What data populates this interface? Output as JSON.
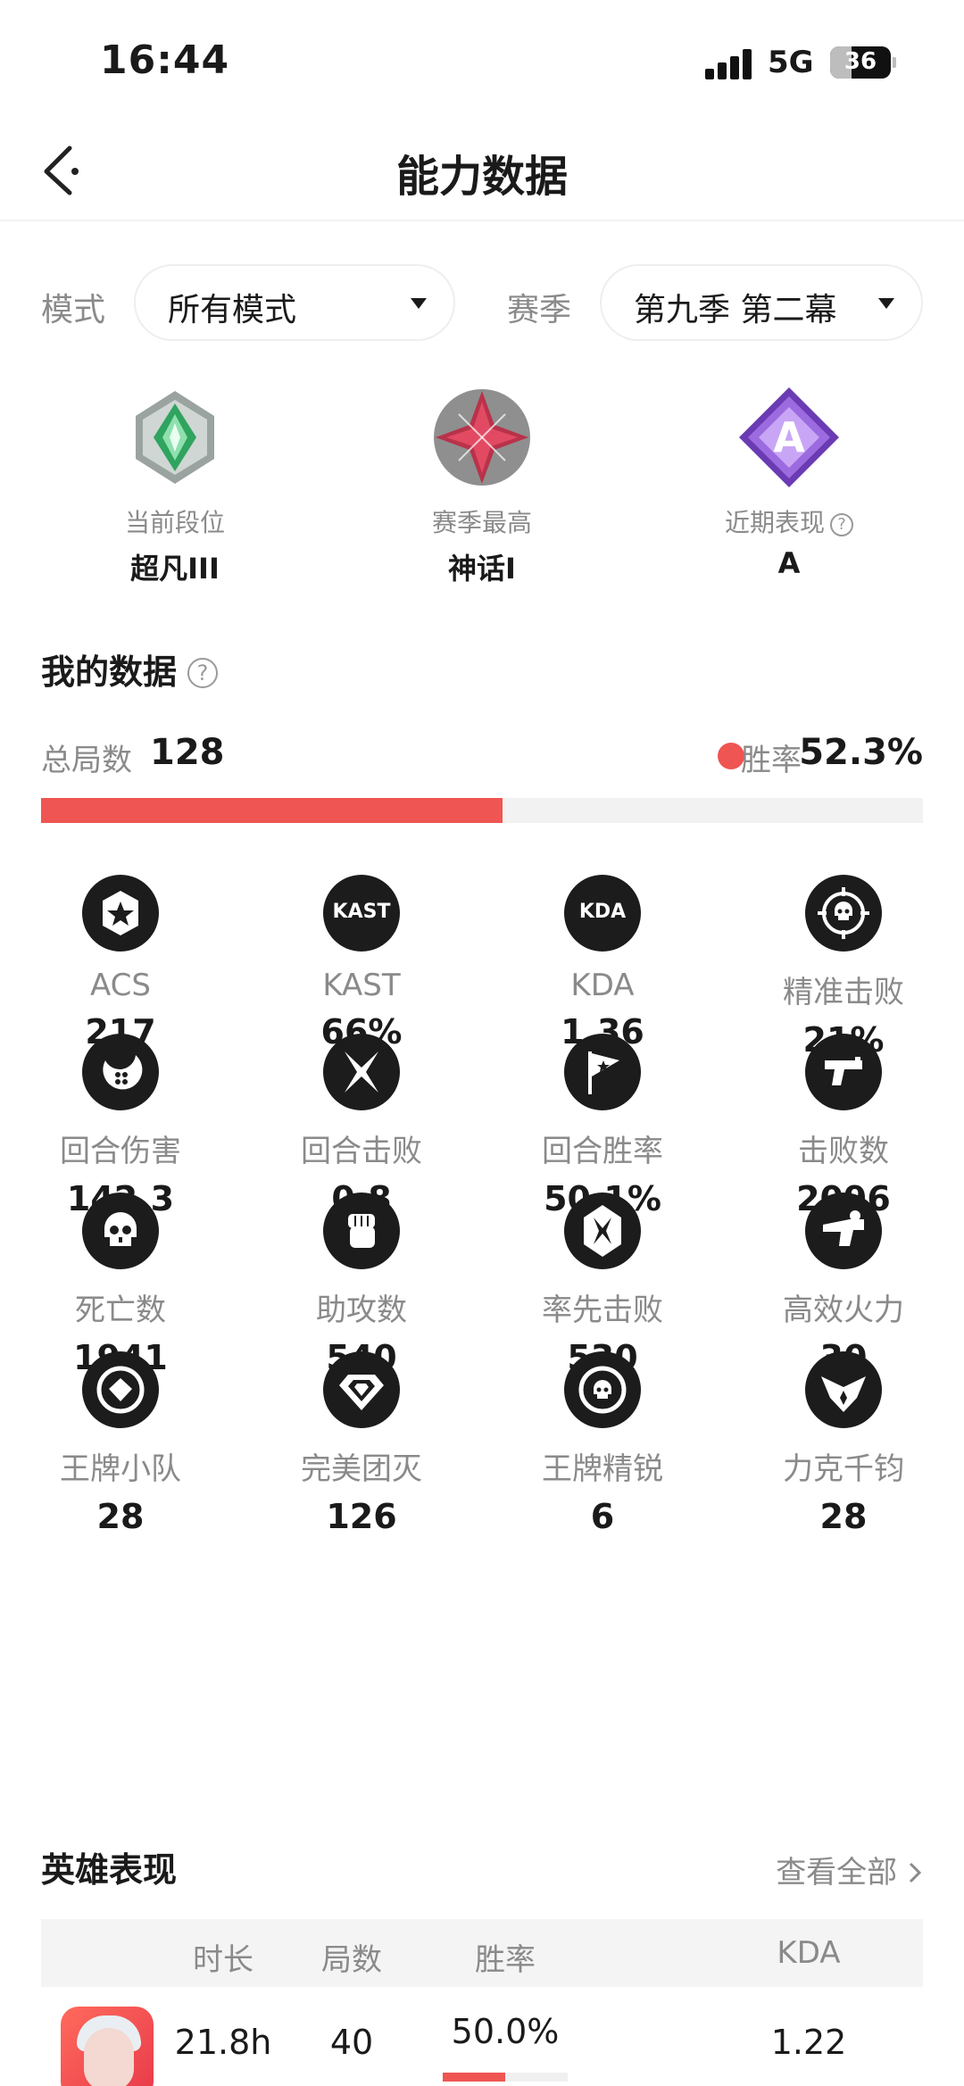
{
  "status_bar": {
    "time": "16:44",
    "network": "5G",
    "battery": "36",
    "battery_level": 0.36
  },
  "nav": {
    "title": "能力数据"
  },
  "filters": {
    "mode_label": "模式",
    "mode_value": "所有模式",
    "season_label": "赛季",
    "season_value": "第九季 第二幕"
  },
  "ranks": [
    {
      "caption": "当前段位",
      "value": "超凡III",
      "icon": "diamond-rank-emblem-icon"
    },
    {
      "caption": "赛季最高",
      "value": "神话I",
      "icon": "mythic-rank-emblem-icon"
    },
    {
      "caption": "近期表现",
      "value": "A",
      "icon": "grade-a-emblem-icon"
    }
  ],
  "my_data": {
    "title": "我的数据",
    "total_label": "总局数",
    "total_value": "128",
    "win_label": "胜率",
    "win_value": "52.3%",
    "win_rate": 0.523,
    "accent_color": "#ef5552"
  },
  "stats": [
    {
      "label": "ACS",
      "value": "217",
      "icon": "star-badge-icon"
    },
    {
      "label": "KAST",
      "value": "66%",
      "icon": "kast-icon",
      "icon_text": "KAST"
    },
    {
      "label": "KDA",
      "value": "1.36",
      "icon": "kda-icon",
      "icon_text": "KDA"
    },
    {
      "label": "精准击败",
      "value": "21%",
      "icon": "crosshair-skull-icon"
    },
    {
      "label": "回合伤害",
      "value": "142.3",
      "icon": "damage-icon"
    },
    {
      "label": "回合击败",
      "value": "0.8",
      "icon": "crossed-blades-icon"
    },
    {
      "label": "回合胜率",
      "value": "50.1%",
      "icon": "flag-icon"
    },
    {
      "label": "击败数",
      "value": "2096",
      "icon": "pistol-icon"
    },
    {
      "label": "死亡数",
      "value": "1941",
      "icon": "skull-icon"
    },
    {
      "label": "助攻数",
      "value": "540",
      "icon": "fist-icon"
    },
    {
      "label": "率先击败",
      "value": "530",
      "icon": "first-blood-icon"
    },
    {
      "label": "高效火力",
      "value": "30",
      "icon": "rifle-icon"
    },
    {
      "label": "王牌小队",
      "value": "28",
      "icon": "ace-squad-icon"
    },
    {
      "label": "完美团灭",
      "value": "126",
      "icon": "diamond-icon"
    },
    {
      "label": "王牌精锐",
      "value": "6",
      "icon": "elite-skull-icon"
    },
    {
      "label": "力克千钧",
      "value": "28",
      "icon": "clutch-wings-icon"
    }
  ],
  "heroes": {
    "title": "英雄表现",
    "view_all": "查看全部",
    "columns": [
      "时长",
      "局数",
      "胜率",
      "KDA"
    ],
    "rows": [
      {
        "icon": "agent-avatar-icon",
        "duration": "21.8h",
        "games": "40",
        "win_rate": "50.0%",
        "win_fraction": 0.5,
        "kda": "1.22"
      }
    ]
  }
}
